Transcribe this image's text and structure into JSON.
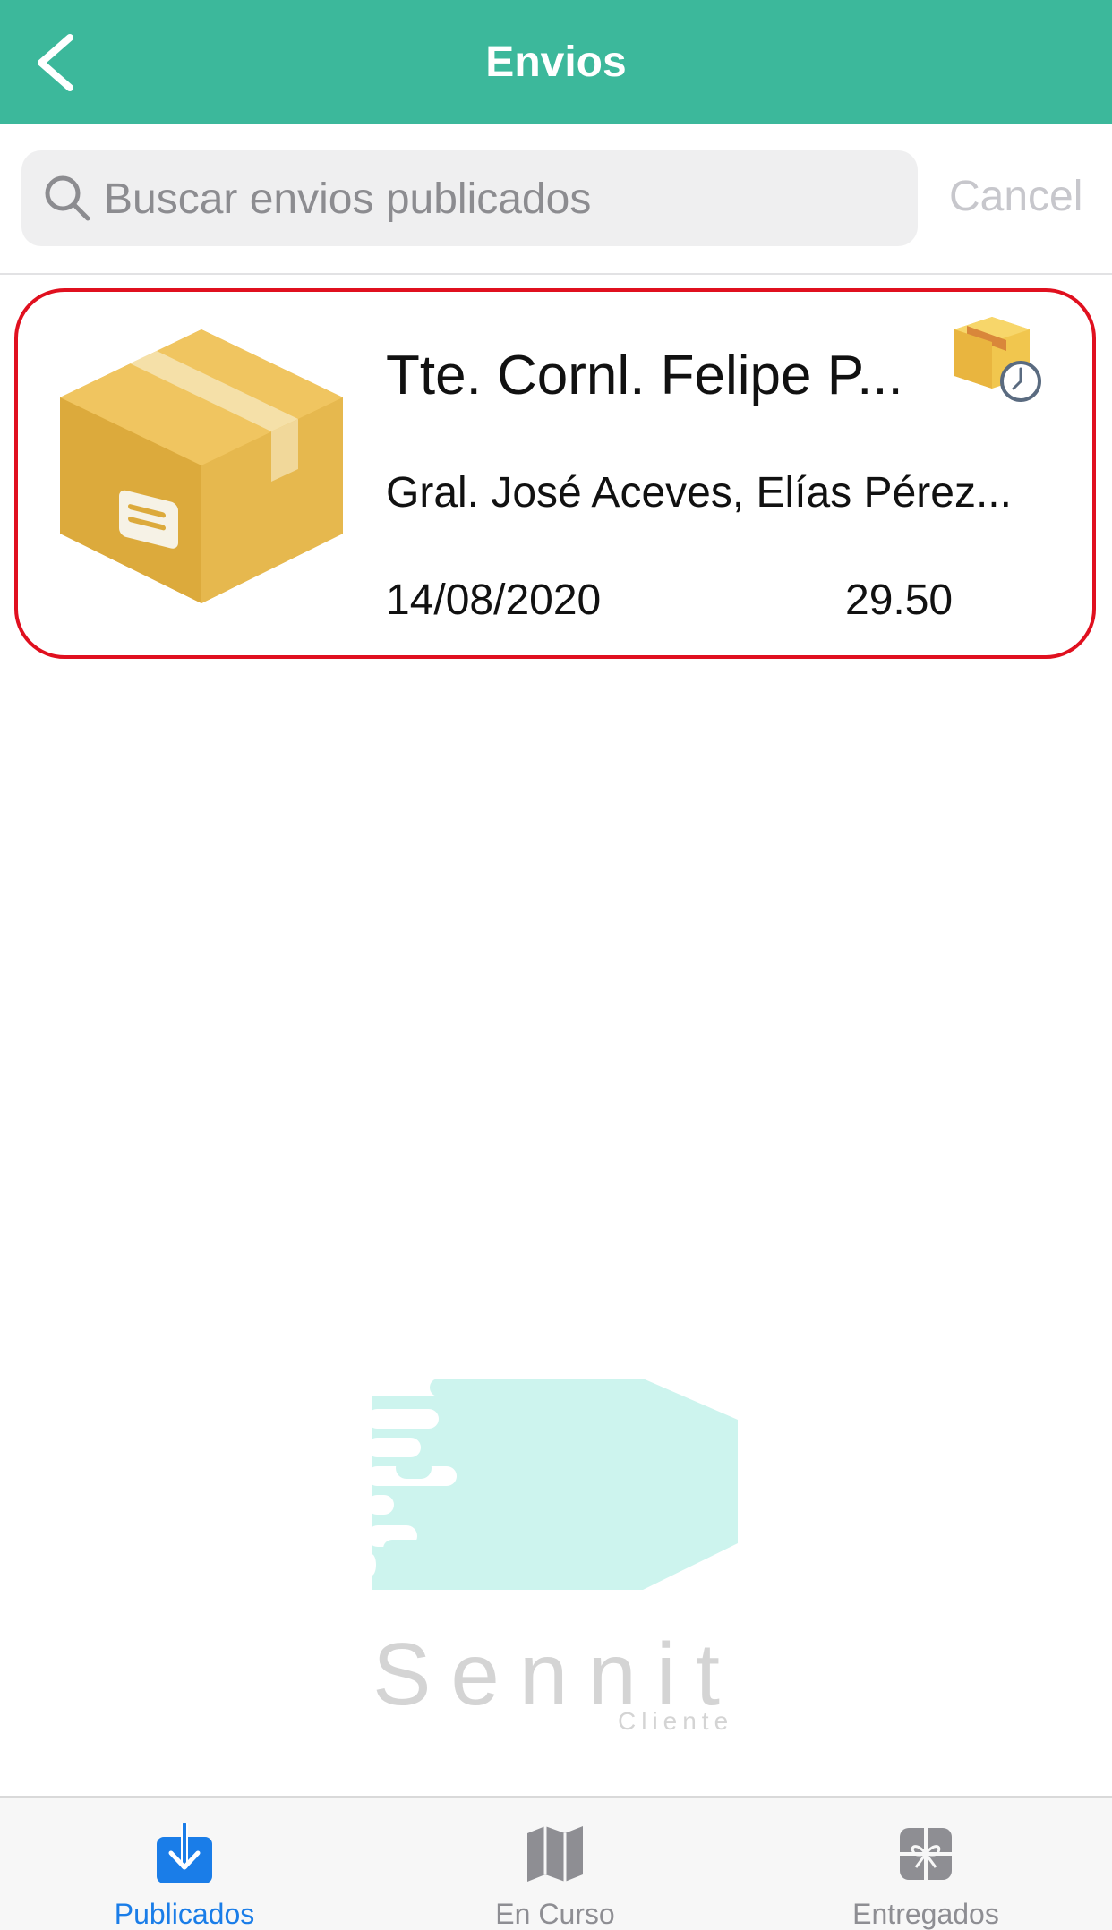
{
  "navbar": {
    "title": "Envios"
  },
  "search": {
    "placeholder": "Buscar envios publicados",
    "cancel_label": "Cancel"
  },
  "shipments": [
    {
      "title": "Tte. Cornl. Felipe P...",
      "address": "Gral. José Aceves, Elías Pérez...",
      "date": "14/08/2020",
      "price": "29.50",
      "status_icon": "box-clock-icon"
    }
  ],
  "brand": {
    "name": "Sennit",
    "subtitle": "Cliente"
  },
  "tabbar": {
    "items": [
      {
        "label": "Publicados",
        "icon": "download-box-icon",
        "active": true
      },
      {
        "label": "En Curso",
        "icon": "map-icon",
        "active": false
      },
      {
        "label": "Entregados",
        "icon": "gift-icon",
        "active": false
      }
    ]
  },
  "colors": {
    "navbar": "#3cb89b",
    "highlight_border": "#e0101f",
    "tab_active": "#1a7de8",
    "tab_inactive": "#8e8e93"
  }
}
